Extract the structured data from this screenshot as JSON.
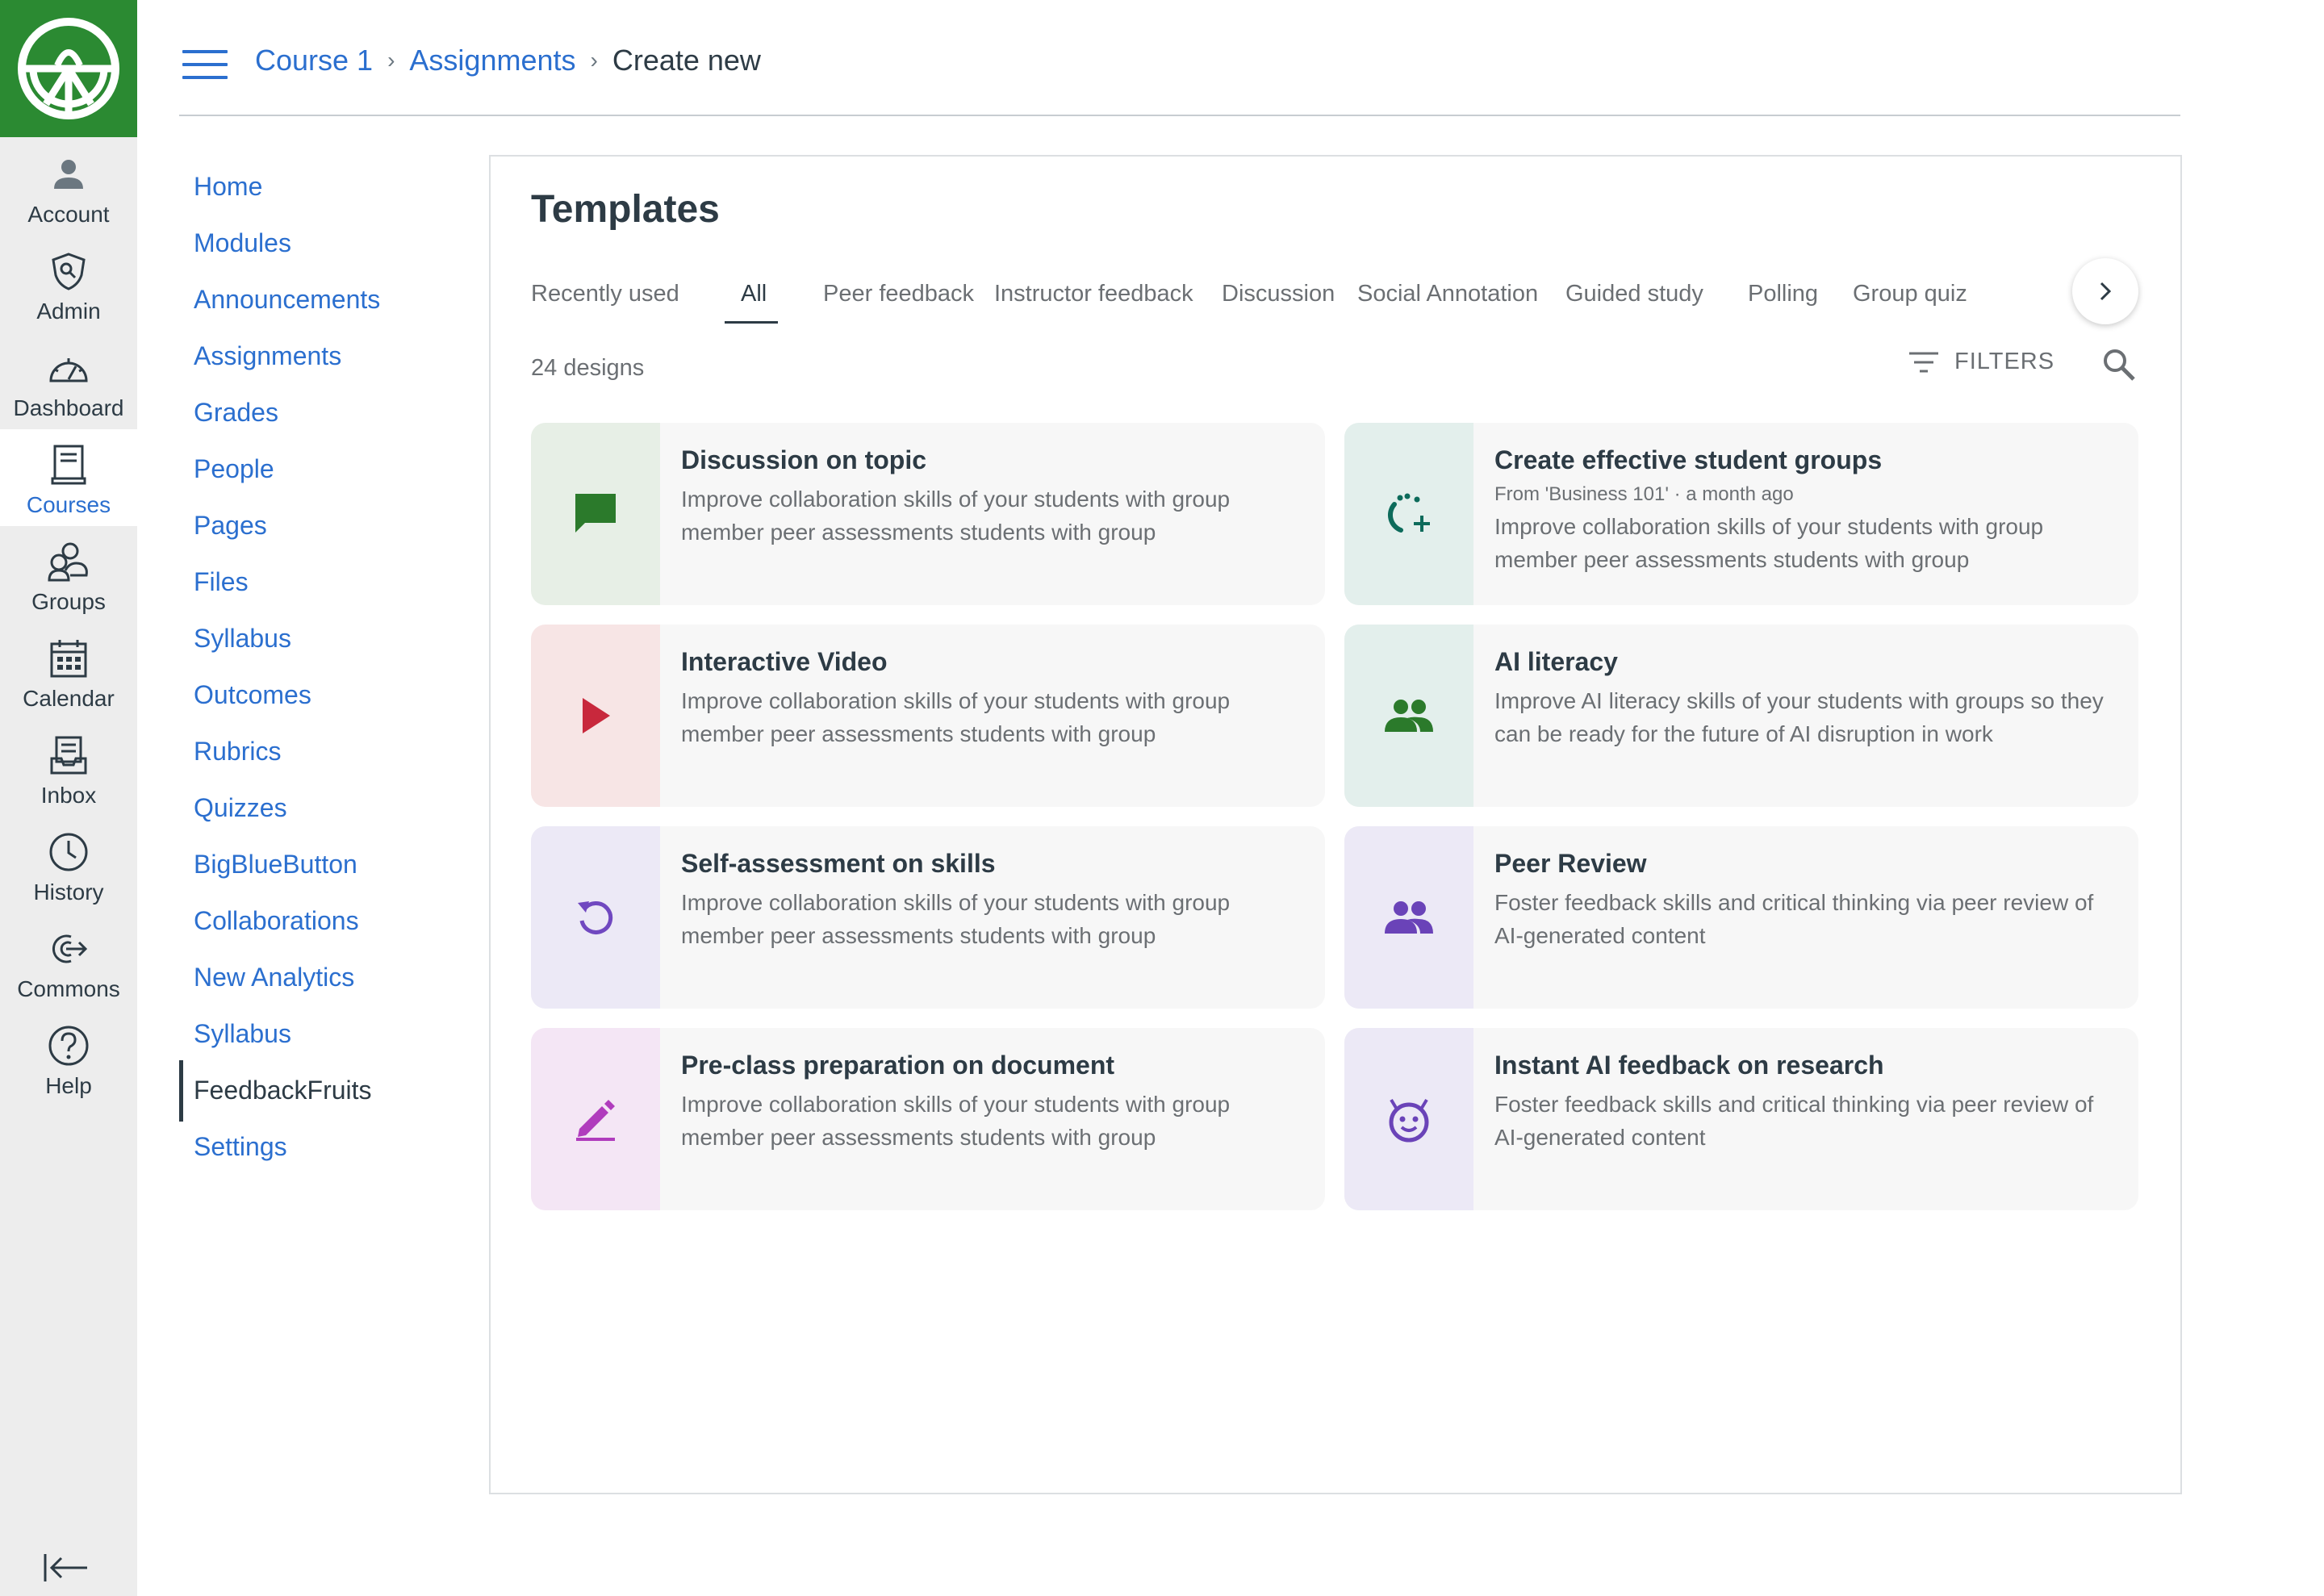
{
  "global_nav": {
    "items": [
      {
        "label": "Account",
        "icon": "account-icon"
      },
      {
        "label": "Admin",
        "icon": "admin-shield-icon"
      },
      {
        "label": "Dashboard",
        "icon": "dashboard-gauge-icon"
      },
      {
        "label": "Courses",
        "icon": "courses-book-icon",
        "active": true
      },
      {
        "label": "Groups",
        "icon": "groups-people-icon"
      },
      {
        "label": "Calendar",
        "icon": "calendar-icon"
      },
      {
        "label": "Inbox",
        "icon": "inbox-icon"
      },
      {
        "label": "History",
        "icon": "history-clock-icon"
      },
      {
        "label": "Commons",
        "icon": "commons-icon"
      },
      {
        "label": "Help",
        "icon": "help-question-icon"
      }
    ],
    "brand_color": "#2b8a32"
  },
  "breadcrumb": {
    "items": [
      "Course 1",
      "Assignments",
      "Create new"
    ]
  },
  "course_nav": {
    "items": [
      "Home",
      "Modules",
      "Announcements",
      "Assignments",
      "Grades",
      "People",
      "Pages",
      "Files",
      "Syllabus",
      "Outcomes",
      "Rubrics",
      "Quizzes",
      "BigBlueButton",
      "Collaborations",
      "New Analytics",
      "Syllabus",
      "FeedbackFruits",
      "Settings"
    ],
    "active": "FeedbackFruits"
  },
  "templates": {
    "title": "Templates",
    "tabs": [
      "Recently used",
      "All",
      "Peer feedback",
      "Instructor feedback",
      "Discussion",
      "Social Annotation",
      "Guided study",
      "Polling",
      "Group quiz"
    ],
    "active_tab": "All",
    "count_label": "24 designs",
    "filters_label": "FILTERS",
    "cards": [
      {
        "title": "Discussion on topic",
        "meta": "",
        "desc": "Improve collaboration skills of your students with group member peer assessments students with group",
        "icon": "chat-bubble-icon",
        "color": "#e7efe6",
        "icon_color": "#2b7a2b"
      },
      {
        "title": "Create effective student groups",
        "meta": "From 'Business 101' · a month ago",
        "desc": "Improve collaboration skills of your students with group member peer assessments students with group",
        "icon": "group-add-icon",
        "color": "#e3efec",
        "icon_color": "#0d6b5b"
      },
      {
        "title": "Interactive Video",
        "meta": "",
        "desc": "Improve collaboration skills of your students with group member peer assessments students with group",
        "icon": "play-icon",
        "color": "#f7e5e5",
        "icon_color": "#c8283c"
      },
      {
        "title": "AI literacy",
        "meta": "",
        "desc": "Improve AI literacy skills of your students with groups so they can be ready for the future of AI disruption in work",
        "icon": "people-icon",
        "color": "#e3efec",
        "icon_color": "#2b7a2b"
      },
      {
        "title": "Self-assessment on skills",
        "meta": "",
        "desc": "Improve collaboration skills of your students with group member peer assessments students with group",
        "icon": "replay-icon",
        "color": "#ece9f6",
        "icon_color": "#7048c0"
      },
      {
        "title": "Peer Review",
        "meta": "",
        "desc": "Foster feedback skills and critical thinking via peer review of AI-generated content",
        "icon": "people-icon",
        "color": "#ece9f6",
        "icon_color": "#6a43b8"
      },
      {
        "title": "Pre-class preparation on document",
        "meta": "",
        "desc": "Improve collaboration skills of your students with group member peer assessments students with group",
        "icon": "pencil-icon",
        "color": "#f4e6f5",
        "icon_color": "#b03cbd"
      },
      {
        "title": "Instant AI feedback on research",
        "meta": "",
        "desc": "Foster feedback skills and critical thinking via peer review of AI-generated content",
        "icon": "robot-face-icon",
        "color": "#ece9f6",
        "icon_color": "#6a43b8"
      }
    ]
  }
}
